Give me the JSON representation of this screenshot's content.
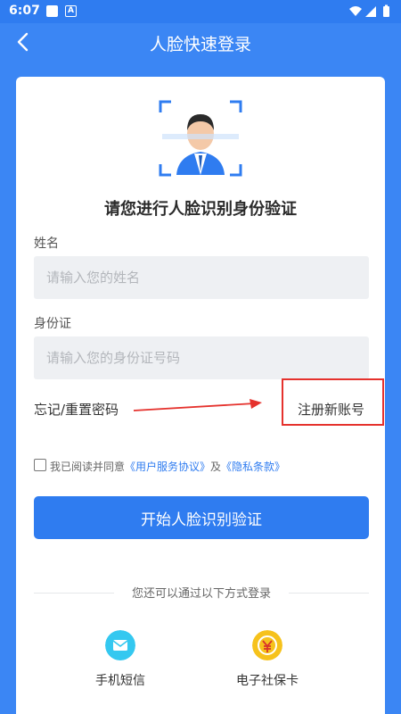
{
  "status_bar": {
    "time": "6:07",
    "icons": [
      "notification-square-icon",
      "a-badge-icon",
      "wifi-icon",
      "signal-icon",
      "battery-icon"
    ]
  },
  "header": {
    "title": "人脸快速登录",
    "back_icon": "chevron-left-icon"
  },
  "form": {
    "heading": "请您进行人脸识别身份验证",
    "name_label": "姓名",
    "name_placeholder": "请输入您的姓名",
    "name_value": "",
    "id_label": "身份证",
    "id_placeholder": "请输入您的身份证号码",
    "id_value": "",
    "forgot": "忘记/重置密码",
    "register": "注册新账号"
  },
  "agreement": {
    "checked": false,
    "prefix": "我已阅读并同意",
    "user_agreement": "《用户服务协议》",
    "and": "及",
    "privacy": "《隐私条款》"
  },
  "start_button": "开始人脸识别验证",
  "alt_login": {
    "divider": "您还可以通过以下方式登录",
    "options": [
      {
        "label": "手机短信",
        "icon": "envelope-icon",
        "color": "#34c8f0"
      },
      {
        "label": "电子社保卡",
        "icon": "social-security-card-icon",
        "color": "#f6c21c"
      }
    ]
  },
  "colors": {
    "primary": "#2f7cf0",
    "header_bg": "#3b86f4",
    "annotation_red": "#e5322d"
  }
}
